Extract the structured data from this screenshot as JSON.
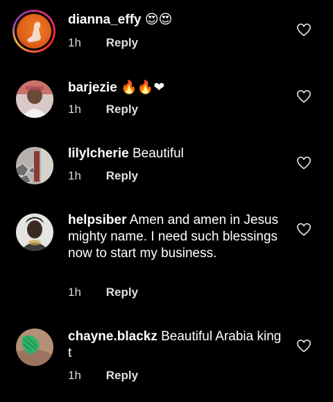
{
  "comments": [
    {
      "username": "dianna_effy",
      "text": "",
      "emoji": "😍😍",
      "time": "1h",
      "reply": "Reply"
    },
    {
      "username": "barjezie",
      "text": "",
      "emoji": "🔥🔥❤",
      "time": "1h",
      "reply": "Reply"
    },
    {
      "username": "lilylcherie",
      "text": " Beautiful",
      "emoji": "",
      "time": "1h",
      "reply": "Reply"
    },
    {
      "username": "helpsiber",
      "text": " Amen and amen in Jesus mighty name. I need such blessings now to start my business.",
      "emoji": "",
      "time": "1h",
      "reply": "Reply"
    },
    {
      "username": "chayne.blackz",
      "text": " Beautiful Arabia king t",
      "emoji": "",
      "time": "1h",
      "reply": "Reply"
    }
  ],
  "icons": {
    "like": "heart-outline-icon"
  },
  "colors": {
    "background": "#000000",
    "text": "#ffffff",
    "story_ring_start": "#c13584",
    "story_ring_end": "#fcaf45"
  }
}
